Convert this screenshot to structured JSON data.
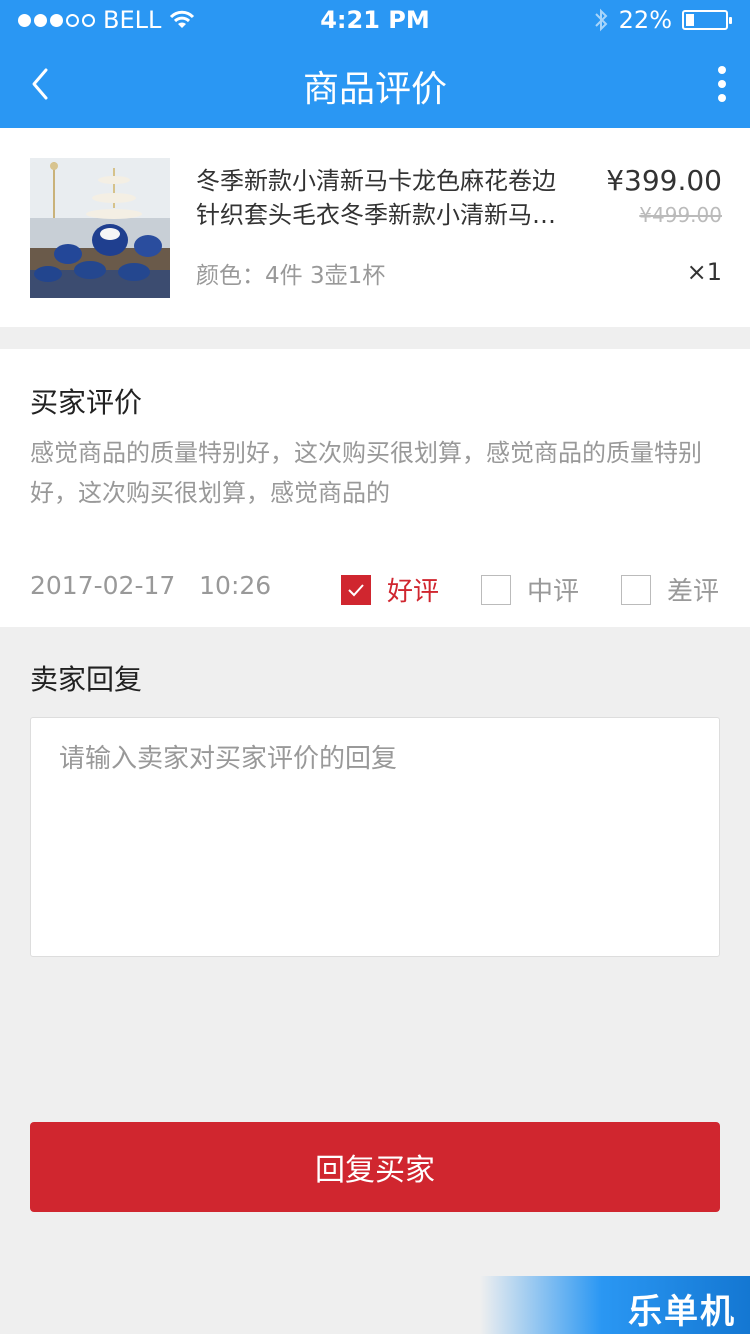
{
  "status_bar": {
    "carrier": "BELL",
    "time": "4:21 PM",
    "battery": "22%",
    "battery_level": 0.22
  },
  "nav": {
    "title": "商品评价"
  },
  "product": {
    "title": "冬季新款小清新马卡龙色麻花卷边针织套头毛衣冬季新款小清新马卡龙色麻花卷边针织套头毛衣",
    "spec": "颜色：4件 3壶1杯",
    "price": "¥399.00",
    "original_price": "¥499.00",
    "quantity": "×1"
  },
  "review": {
    "heading": "买家评价",
    "text": "感觉商品的质量特别好，这次购买很划算，感觉商品的质量特别好，这次购买很划算，感觉商品的",
    "date": "2017-02-17",
    "time": "10:26",
    "ratings": [
      {
        "label": "好评",
        "checked": true
      },
      {
        "label": "中评",
        "checked": false
      },
      {
        "label": "差评",
        "checked": false
      }
    ]
  },
  "reply": {
    "heading": "卖家回复",
    "placeholder": "请输入卖家对买家评价的回复",
    "value": ""
  },
  "submit_label": "回复买家",
  "watermark": "乐单机",
  "colors": {
    "primary": "#2a97f3",
    "accent": "#d0262f",
    "muted": "#999999"
  }
}
